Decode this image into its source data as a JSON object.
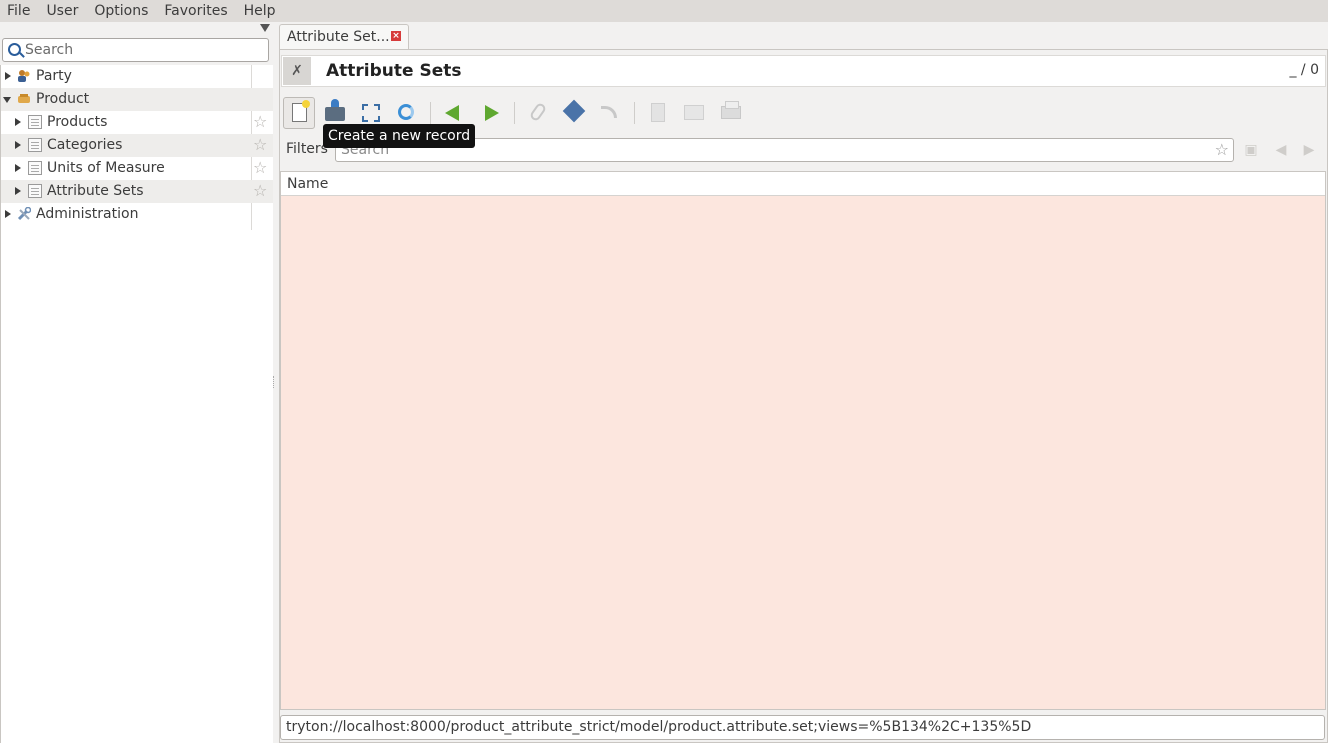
{
  "menu": [
    "File",
    "User",
    "Options",
    "Favorites",
    "Help"
  ],
  "sidebar": {
    "search_placeholder": "Search",
    "items": [
      {
        "label": "Party",
        "icon": "party-icon",
        "expanded": false,
        "favorite": false
      },
      {
        "label": "Product",
        "icon": "product-icon",
        "expanded": true,
        "favorite": false
      },
      {
        "label": "Products",
        "icon": "document-icon",
        "favorite": false
      },
      {
        "label": "Categories",
        "icon": "document-icon",
        "favorite": false
      },
      {
        "label": "Units of Measure",
        "icon": "document-icon",
        "favorite": false
      },
      {
        "label": "Attribute Sets",
        "icon": "document-icon",
        "favorite": false,
        "selected": true
      },
      {
        "label": "Administration",
        "icon": "administration-icon",
        "expanded": false
      }
    ]
  },
  "tab": {
    "label": "Attribute Set...",
    "close": "×"
  },
  "form": {
    "title": "Attribute Sets",
    "record_count": "_ / 0"
  },
  "toolbar": {
    "tooltip": "Create a new record",
    "buttons": [
      "new",
      "save",
      "switch-view",
      "reload",
      "previous",
      "next",
      "attachment",
      "action",
      "relate",
      "report",
      "email",
      "print"
    ]
  },
  "filters": {
    "label": "Filters",
    "placeholder": "Search"
  },
  "grid": {
    "columns": [
      "Name"
    ],
    "rows": [],
    "background": "#fce6de"
  },
  "url": "tryton://localhost:8000/product_attribute_strict/model/product.attribute.set;views=%5B134%2C+135%5D"
}
